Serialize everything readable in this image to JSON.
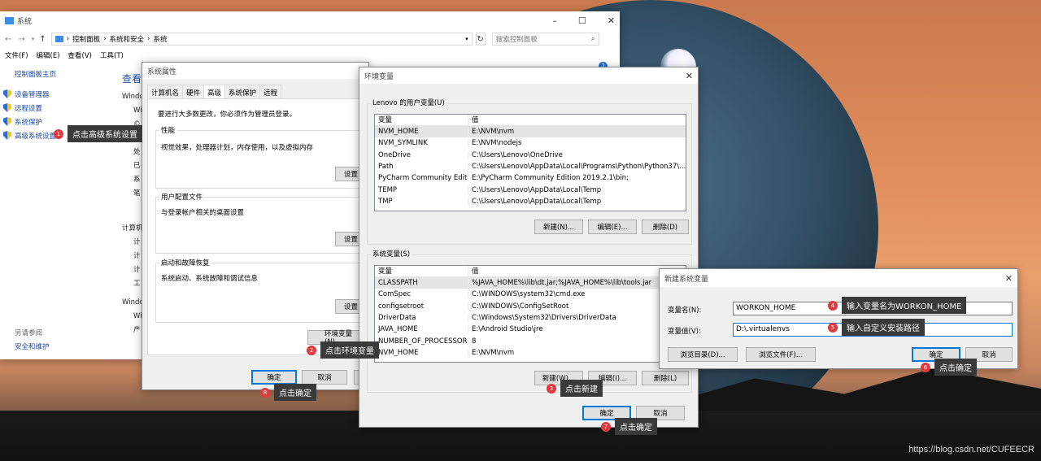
{
  "watermark": "https://blog.csdn.net/CUFEECR",
  "system_window": {
    "title": "系统",
    "breadcrumb": [
      "控制面板",
      "系统和安全",
      "系统"
    ],
    "search_placeholder": "搜索控制面板",
    "menu": [
      "文件(F)",
      "编辑(E)",
      "查看(V)",
      "工具(T)"
    ],
    "sidebar_home": "控制面板主页",
    "sidebar_items": [
      "设备管理器",
      "远程设置",
      "系统保护",
      "高级系统设置"
    ],
    "see_also": "另请参阅",
    "see_also_item": "安全和维护",
    "heading_partial": "查看",
    "partial_rows": [
      "Windo",
      "Wi",
      "©",
      "系统",
      "处",
      "已",
      "系",
      "笔",
      "计算机",
      "计",
      "计",
      "计",
      "工",
      "Windo",
      "Wi",
      "产"
    ]
  },
  "sys_props": {
    "title": "系统属性",
    "tabs": [
      "计算机名",
      "硬件",
      "高级",
      "系统保护",
      "远程"
    ],
    "active_tab": "高级",
    "notice": "要进行大多数更改，你必须作为管理员登录。",
    "perf_label": "性能",
    "perf_desc": "视觉效果，处理器计划，内存使用，以及虚拟内存",
    "perf_btn": "设置",
    "profile_label": "用户配置文件",
    "profile_desc": "与登录帐户相关的桌面设置",
    "profile_btn": "设置",
    "startup_label": "启动和故障恢复",
    "startup_desc": "系统启动、系统故障和调试信息",
    "startup_btn": "设置",
    "env_btn": "环境变量(N)...",
    "ok": "确定",
    "cancel": "取消"
  },
  "env_vars": {
    "title": "环境变量",
    "user_group": "Lenovo 的用户变量(U)",
    "col_var": "变量",
    "col_val": "值",
    "user_rows": [
      {
        "name": "NVM_HOME",
        "value": "E:\\NVM\\nvm"
      },
      {
        "name": "NVM_SYMLINK",
        "value": "E:\\NVM\\nodejs"
      },
      {
        "name": "OneDrive",
        "value": "C:\\Users\\Lenovo\\OneDrive"
      },
      {
        "name": "Path",
        "value": "C:\\Users\\Lenovo\\AppData\\Local\\Programs\\Python\\Python37\\..."
      },
      {
        "name": "PyCharm Community Editi...",
        "value": "E:\\PyCharm Community Edition 2019.2.1\\bin;"
      },
      {
        "name": "TEMP",
        "value": "C:\\Users\\Lenovo\\AppData\\Local\\Temp"
      },
      {
        "name": "TMP",
        "value": "C:\\Users\\Lenovo\\AppData\\Local\\Temp"
      }
    ],
    "user_new": "新建(N)...",
    "user_edit": "编辑(E)...",
    "user_delete": "删除(D)",
    "sys_group": "系统变量(S)",
    "sys_rows": [
      {
        "name": "CLASSPATH",
        "value": "%JAVA_HOME%\\lib\\dt.jar;%JAVA_HOME%\\lib\\tools.jar"
      },
      {
        "name": "ComSpec",
        "value": "C:\\WINDOWS\\system32\\cmd.exe"
      },
      {
        "name": "configsetroot",
        "value": "C:\\WINDOWS\\ConfigSetRoot"
      },
      {
        "name": "DriverData",
        "value": "C:\\Windows\\System32\\Drivers\\DriverData"
      },
      {
        "name": "JAVA_HOME",
        "value": "E:\\Android Studio\\jre"
      },
      {
        "name": "NUMBER_OF_PROCESSORS",
        "value": "8"
      },
      {
        "name": "NVM_HOME",
        "value": "E:\\NVM\\nvm"
      }
    ],
    "sys_new": "新建(W)...",
    "sys_edit": "编辑(I)...",
    "sys_delete": "删除(L)",
    "ok": "确定",
    "cancel": "取消"
  },
  "new_var": {
    "title": "新建系统变量",
    "name_label": "变量名(N):",
    "name_value": "WORKON_HOME",
    "value_label": "变量值(V):",
    "value_value": "D:\\.virtualenvs",
    "browse_dir": "浏览目录(D)...",
    "browse_file": "浏览文件(F)...",
    "ok": "确定",
    "cancel": "取消"
  },
  "callouts": [
    {
      "num": "1",
      "text": "点击高级系统设置"
    },
    {
      "num": "2",
      "text": "点击环境变量"
    },
    {
      "num": "3",
      "text": "点击新建"
    },
    {
      "num": "4",
      "text": "输入变量名为WORKON_HOME"
    },
    {
      "num": "5",
      "text": "输入自定义安装路径"
    },
    {
      "num": "6",
      "text": "点击确定"
    },
    {
      "num": "7",
      "text": "点击确定"
    },
    {
      "num": "8",
      "text": "点击确定"
    }
  ]
}
